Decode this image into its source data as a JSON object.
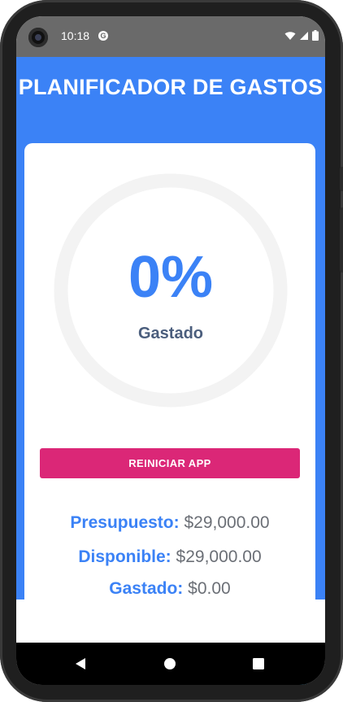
{
  "status_bar": {
    "time": "10:18",
    "app_icon": "G",
    "icons": [
      "wifi-icon",
      "signal-icon",
      "battery-icon"
    ]
  },
  "header": {
    "title": "PLANIFICADOR DE GASTOS"
  },
  "progress": {
    "percentage_text": "0%",
    "percentage_value": 0,
    "caption": "Gastado"
  },
  "reset_button": {
    "label": "REINICIAR APP"
  },
  "stats": {
    "budget_label": "Presupuesto:",
    "budget_value": "$29,000.00",
    "available_label": "Disponible:",
    "available_value": "$29,000.00",
    "spent_label": "Gastado:",
    "spent_value": "$0.00"
  },
  "fab": {
    "icon": "plus-icon"
  },
  "nav_bar": {
    "buttons": [
      "back-icon",
      "home-icon",
      "recents-icon"
    ]
  },
  "colors": {
    "primary": "#3b82f6",
    "reset": "#db2777",
    "fab": "#3ab0f0",
    "track": "#f3f3f3"
  }
}
